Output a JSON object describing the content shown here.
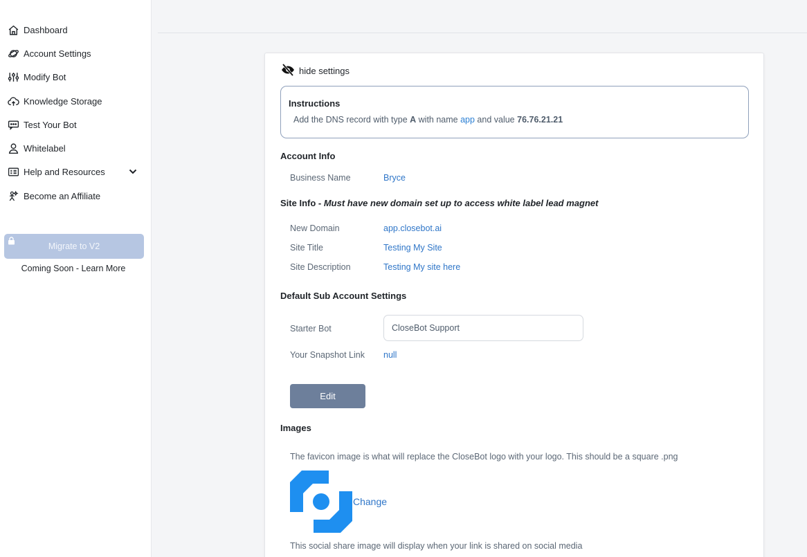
{
  "sidebar": {
    "items": [
      {
        "label": "Dashboard",
        "icon": "home-icon"
      },
      {
        "label": "Account Settings",
        "icon": "planet-icon"
      },
      {
        "label": "Modify Bot",
        "icon": "sliders-icon"
      },
      {
        "label": "Knowledge Storage",
        "icon": "cloud-upload-icon"
      },
      {
        "label": "Test Your Bot",
        "icon": "chat-bubble-icon"
      },
      {
        "label": "Whitelabel",
        "icon": "user-icon"
      },
      {
        "label": "Help and Resources",
        "icon": "help-icon"
      },
      {
        "label": "Become an Affiliate",
        "icon": "affiliate-icon"
      }
    ],
    "migrate_label": "Migrate to V2",
    "coming_soon": "Coming Soon - Learn More"
  },
  "panel": {
    "hide_label": "hide settings",
    "instructions": {
      "title": "Instructions",
      "pre": "Add the DNS record with type ",
      "type": "A",
      "mid1": " with name ",
      "name": "app",
      "mid2": " and value ",
      "value": "76.76.21.21"
    },
    "account_info": {
      "title": "Account Info",
      "business_name_label": "Business Name",
      "business_name": "Bryce"
    },
    "site_info": {
      "title": "Site Info - ",
      "note": "Must have new domain set up to access white label lead magnet",
      "domain_label": "New Domain",
      "domain": "app.closebot.ai",
      "title_label": "Site Title",
      "site_title": "Testing My Site",
      "desc_label": "Site Description",
      "site_description": "Testing My site here"
    },
    "sub_account": {
      "title": "Default Sub Account Settings",
      "starter_label": "Starter Bot",
      "starter_value": "CloseBot Support",
      "snapshot_label": "Your Snapshot Link",
      "snapshot_value": "null"
    },
    "edit_label": "Edit",
    "images": {
      "title": "Images",
      "favicon_note": "The favicon image is what will replace the CloseBot logo with your logo.  This should be a square .png",
      "change_label": "Change",
      "social_note": "This social share image will display when your link is shared on social media"
    }
  },
  "colors": {
    "accent": "#2f76c8",
    "edit_button": "#6d7f9b",
    "migrate_button": "#b6c6e2",
    "logo_blue": "#1e8ff0"
  }
}
